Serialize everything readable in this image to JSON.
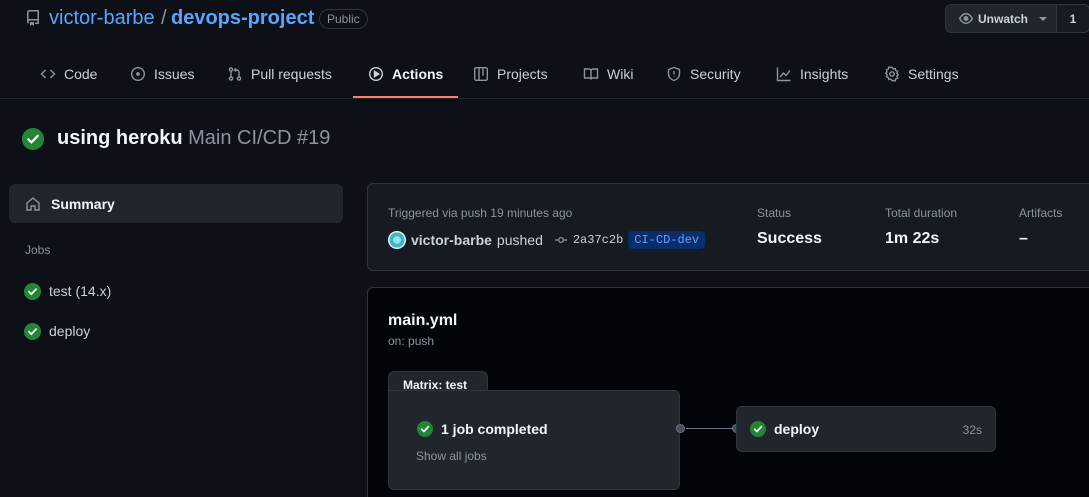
{
  "repo": {
    "owner": "victor-barbe",
    "separator": "/",
    "name": "devops-project",
    "visibility": "Public",
    "watch_label": "Unwatch",
    "watch_count": "1"
  },
  "nav": {
    "tabs": [
      {
        "label": "Code",
        "icon": "code-icon"
      },
      {
        "label": "Issues",
        "icon": "issue-opened-icon"
      },
      {
        "label": "Pull requests",
        "icon": "git-pull-request-icon"
      },
      {
        "label": "Actions",
        "icon": "play-icon",
        "active": true
      },
      {
        "label": "Projects",
        "icon": "table-icon"
      },
      {
        "label": "Wiki",
        "icon": "book-icon"
      },
      {
        "label": "Security",
        "icon": "shield-icon"
      },
      {
        "label": "Insights",
        "icon": "graph-icon"
      },
      {
        "label": "Settings",
        "icon": "gear-icon"
      }
    ]
  },
  "run": {
    "title": "using heroku",
    "workflow": "Main CI/CD #19",
    "status_icon": "check-circle-fill-icon"
  },
  "sidebar": {
    "summary_label": "Summary",
    "jobs_heading": "Jobs",
    "jobs": [
      {
        "label": "test (14.x)"
      },
      {
        "label": "deploy"
      }
    ]
  },
  "info": {
    "triggered": "Triggered via push 19 minutes ago",
    "actor": "victor-barbe",
    "action": "pushed",
    "commit_sha": "2a37c2b",
    "branch": "CI-CD-dev",
    "status_label": "Status",
    "status_value": "Success",
    "duration_label": "Total duration",
    "duration_value": "1m 22s",
    "artifacts_label": "Artifacts",
    "artifacts_value": "–"
  },
  "graph": {
    "workflow_file": "main.yml",
    "trigger": "on: push",
    "matrix_label": "Matrix: test",
    "matrix_status": "1 job completed",
    "show_all": "Show all jobs",
    "deploy_job": "deploy",
    "deploy_duration": "32s"
  },
  "colors": {
    "success": "#238636",
    "accent": "#58a6ff",
    "active_tab": "#f78166"
  }
}
